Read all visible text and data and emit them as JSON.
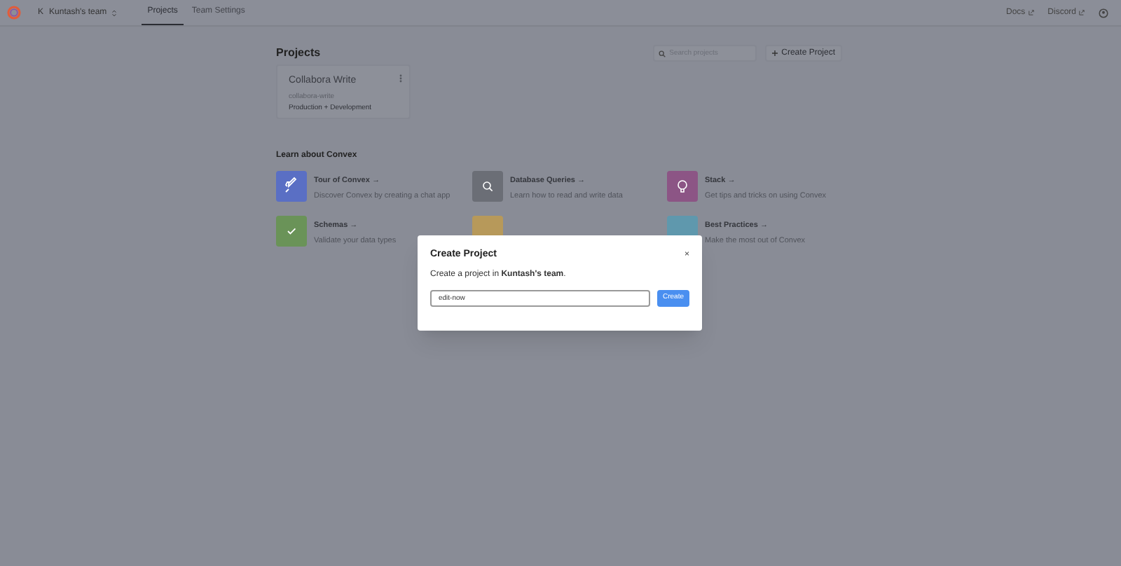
{
  "topbar": {
    "team": {
      "initial": "K",
      "name": "Kuntash's team"
    },
    "tabs": [
      {
        "label": "Projects",
        "selected": true
      },
      {
        "label": "Team Settings",
        "selected": false
      }
    ],
    "links": [
      "Docs",
      "Discord"
    ]
  },
  "projects": {
    "title": "Projects",
    "search": {
      "placeholder": "Search projects"
    },
    "create_button": "Create Project",
    "cards": [
      {
        "name": "Collabora Write",
        "slug": "collabora-write",
        "deployments": "Production + Development"
      }
    ]
  },
  "learn": {
    "title": "Learn about Convex",
    "items": [
      {
        "kind": "rocket",
        "color": "#5a6fc4",
        "title": "Tour of Convex →",
        "description": "Discover Convex by creating a chat app"
      },
      {
        "kind": "search",
        "color": "#6b6e76",
        "title": "Database Queries →",
        "description": "Learn how to read and write data"
      },
      {
        "kind": "bulb",
        "color": "#8c5585",
        "title": "Stack →",
        "description": "Get tips and tricks on using Convex"
      },
      {
        "kind": "check",
        "color": "#6a9358",
        "title": "Schemas →",
        "description": "Validate your data types"
      },
      {
        "kind": "blank",
        "color": "#b7995a"
      },
      {
        "kind": "blank",
        "color": "#5f98ad",
        "title": "Best Practices →",
        "description": "Make the most out of Convex"
      }
    ]
  },
  "dialog": {
    "title": "Create Project",
    "close": "×",
    "message": "Create a project in **Kuntash's team**.",
    "input": {
      "value": "edit-now"
    },
    "submit": "Create"
  }
}
